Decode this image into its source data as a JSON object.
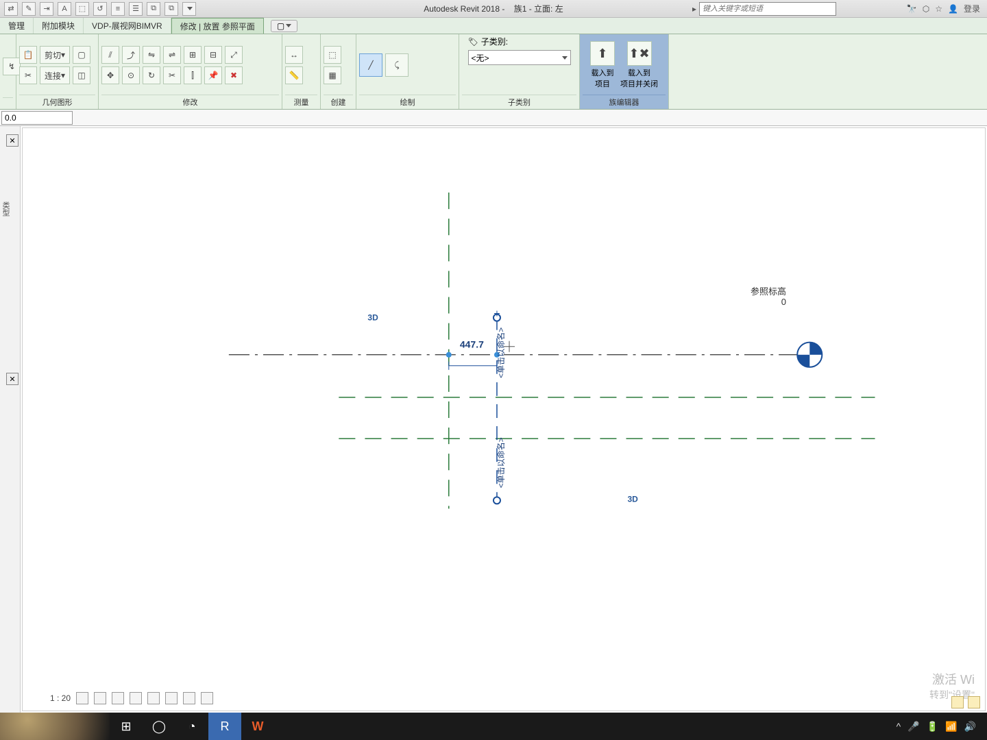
{
  "title": {
    "app": "Autodesk Revit 2018 -",
    "doc": "族1 - 立面: 左"
  },
  "search": {
    "placeholder": "键入关键字或短语"
  },
  "login": "登录",
  "tabs": {
    "mgmt": "管理",
    "addons": "附加模块",
    "vdp": "VDP-展视网BIMVR",
    "active": "修改 | 放置 参照平面"
  },
  "ribbon": {
    "geom": {
      "cut": "剪切",
      "join": "连接",
      "label": "几何图形"
    },
    "modify": {
      "label": "修改"
    },
    "measure": {
      "label": "测量"
    },
    "create": {
      "label": "创建"
    },
    "draw": {
      "label": "绘制"
    },
    "subcat": {
      "title": "子类别:",
      "select": "<无>",
      "label": "子类别"
    },
    "fameditor": {
      "load": "载入到\n项目",
      "loadclose": "载入到\n项目并关闭",
      "label": "族编辑器"
    }
  },
  "optbar": {
    "value": "0.0"
  },
  "props": {
    "label": "类型"
  },
  "canvas": {
    "dim": "447.7",
    "label3d_a": "3D",
    "label3d_b": "3D",
    "click1": "<单击以命名>",
    "click2": "<单击以命名>",
    "level_name": "参照标高",
    "level_val": "0"
  },
  "viewbar": {
    "scale": "1 : 20"
  },
  "watermark": {
    "line1": "激活 Wi",
    "line2": "转到\"设置\""
  }
}
